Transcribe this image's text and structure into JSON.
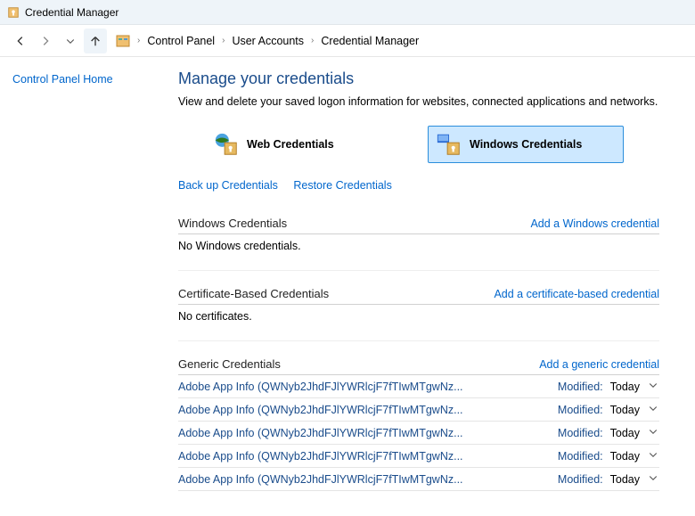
{
  "window": {
    "title": "Credential Manager"
  },
  "breadcrumb": {
    "root": "Control Panel",
    "level1": "User Accounts",
    "level2": "Credential Manager"
  },
  "sidebar": {
    "home": "Control Panel Home"
  },
  "page": {
    "title": "Manage your credentials",
    "desc": "View and delete your saved logon information for websites, connected applications and networks."
  },
  "tiles": {
    "web": "Web Credentials",
    "windows": "Windows Credentials"
  },
  "links": {
    "backup": "Back up Credentials",
    "restore": "Restore Credentials"
  },
  "sections": {
    "windows": {
      "heading": "Windows Credentials",
      "add": "Add a Windows credential",
      "empty": "No Windows credentials."
    },
    "cert": {
      "heading": "Certificate-Based Credentials",
      "add": "Add a certificate-based credential",
      "empty": "No certificates."
    },
    "generic": {
      "heading": "Generic Credentials",
      "add": "Add a generic credential"
    }
  },
  "modified_prefix": "Modified:",
  "generic_items": [
    {
      "name": "Adobe App Info (QWNyb2JhdFJlYWRlcjF7fTIwMTgwNz...",
      "date": "Today"
    },
    {
      "name": "Adobe App Info (QWNyb2JhdFJlYWRlcjF7fTIwMTgwNz...",
      "date": "Today"
    },
    {
      "name": "Adobe App Info (QWNyb2JhdFJlYWRlcjF7fTIwMTgwNz...",
      "date": "Today"
    },
    {
      "name": "Adobe App Info (QWNyb2JhdFJlYWRlcjF7fTIwMTgwNz...",
      "date": "Today"
    },
    {
      "name": "Adobe App Info (QWNyb2JhdFJlYWRlcjF7fTIwMTgwNz...",
      "date": "Today"
    }
  ]
}
